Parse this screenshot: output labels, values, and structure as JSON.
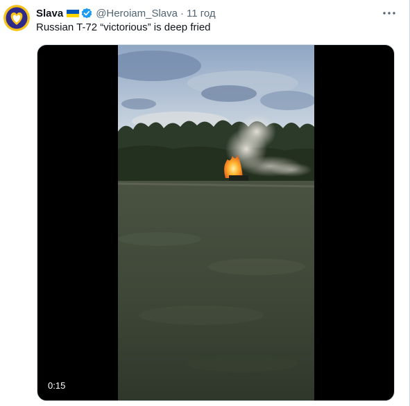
{
  "tweet": {
    "display_name": "Slava",
    "handle": "@Heroiam_Slava",
    "separator": "·",
    "time": "11 год",
    "text": "Russian T-72 “victorious” is deep fried",
    "flag_icon": "ukraine-flag-icon",
    "verified_icon": "verified-badge-icon",
    "more_icon": "more-options-icon"
  },
  "media": {
    "type": "video",
    "duration": "0:15"
  },
  "colors": {
    "accent": "#1d9bf0",
    "secondary_text": "#536471",
    "primary_text": "#0f1419",
    "flag_blue": "#0057b7",
    "flag_yellow": "#ffd700"
  }
}
